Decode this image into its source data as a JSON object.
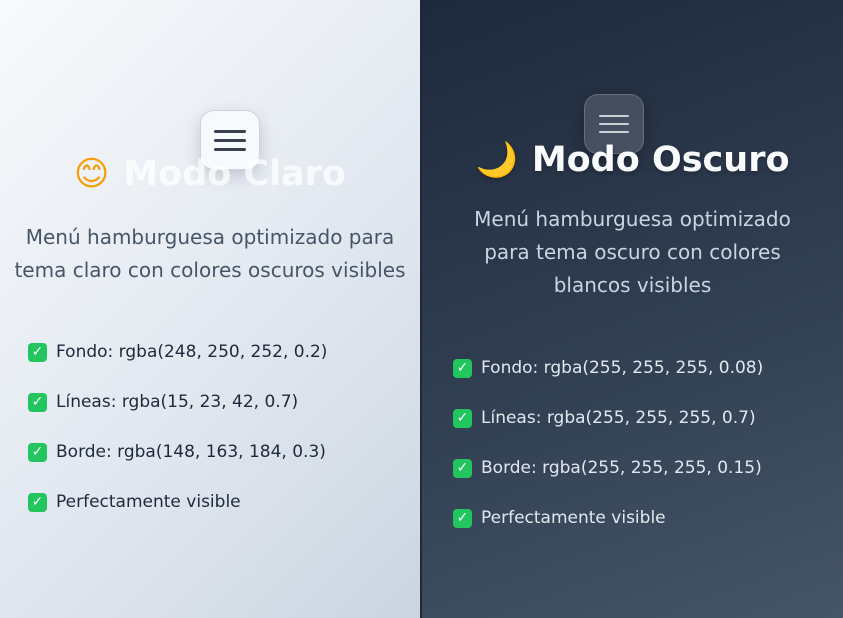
{
  "light": {
    "emoji": "😊",
    "title": "Modo Claro",
    "description": "Menú hamburguesa optimizado para tema claro con colores oscuros visibles",
    "features": [
      "Fondo: rgba(248, 250, 252, 0.2)",
      "Líneas: rgba(15, 23, 42, 0.7)",
      "Borde: rgba(148, 163, 184, 0.3)",
      "Perfectamente visible"
    ]
  },
  "dark": {
    "emoji": "🌙",
    "title": "Modo Oscuro",
    "description": "Menú hamburguesa optimizado para tema oscuro con colores blancos visibles",
    "features": [
      "Fondo: rgba(255, 255, 255, 0.08)",
      "Líneas: rgba(255, 255, 255, 0.7)",
      "Borde: rgba(255, 255, 255, 0.15)",
      "Perfectamente visible"
    ]
  },
  "check_glyph": "✓",
  "colors": {
    "check_green": "#22c55e",
    "light_bg": "#e2e8f0",
    "dark_bg": "#334155"
  }
}
